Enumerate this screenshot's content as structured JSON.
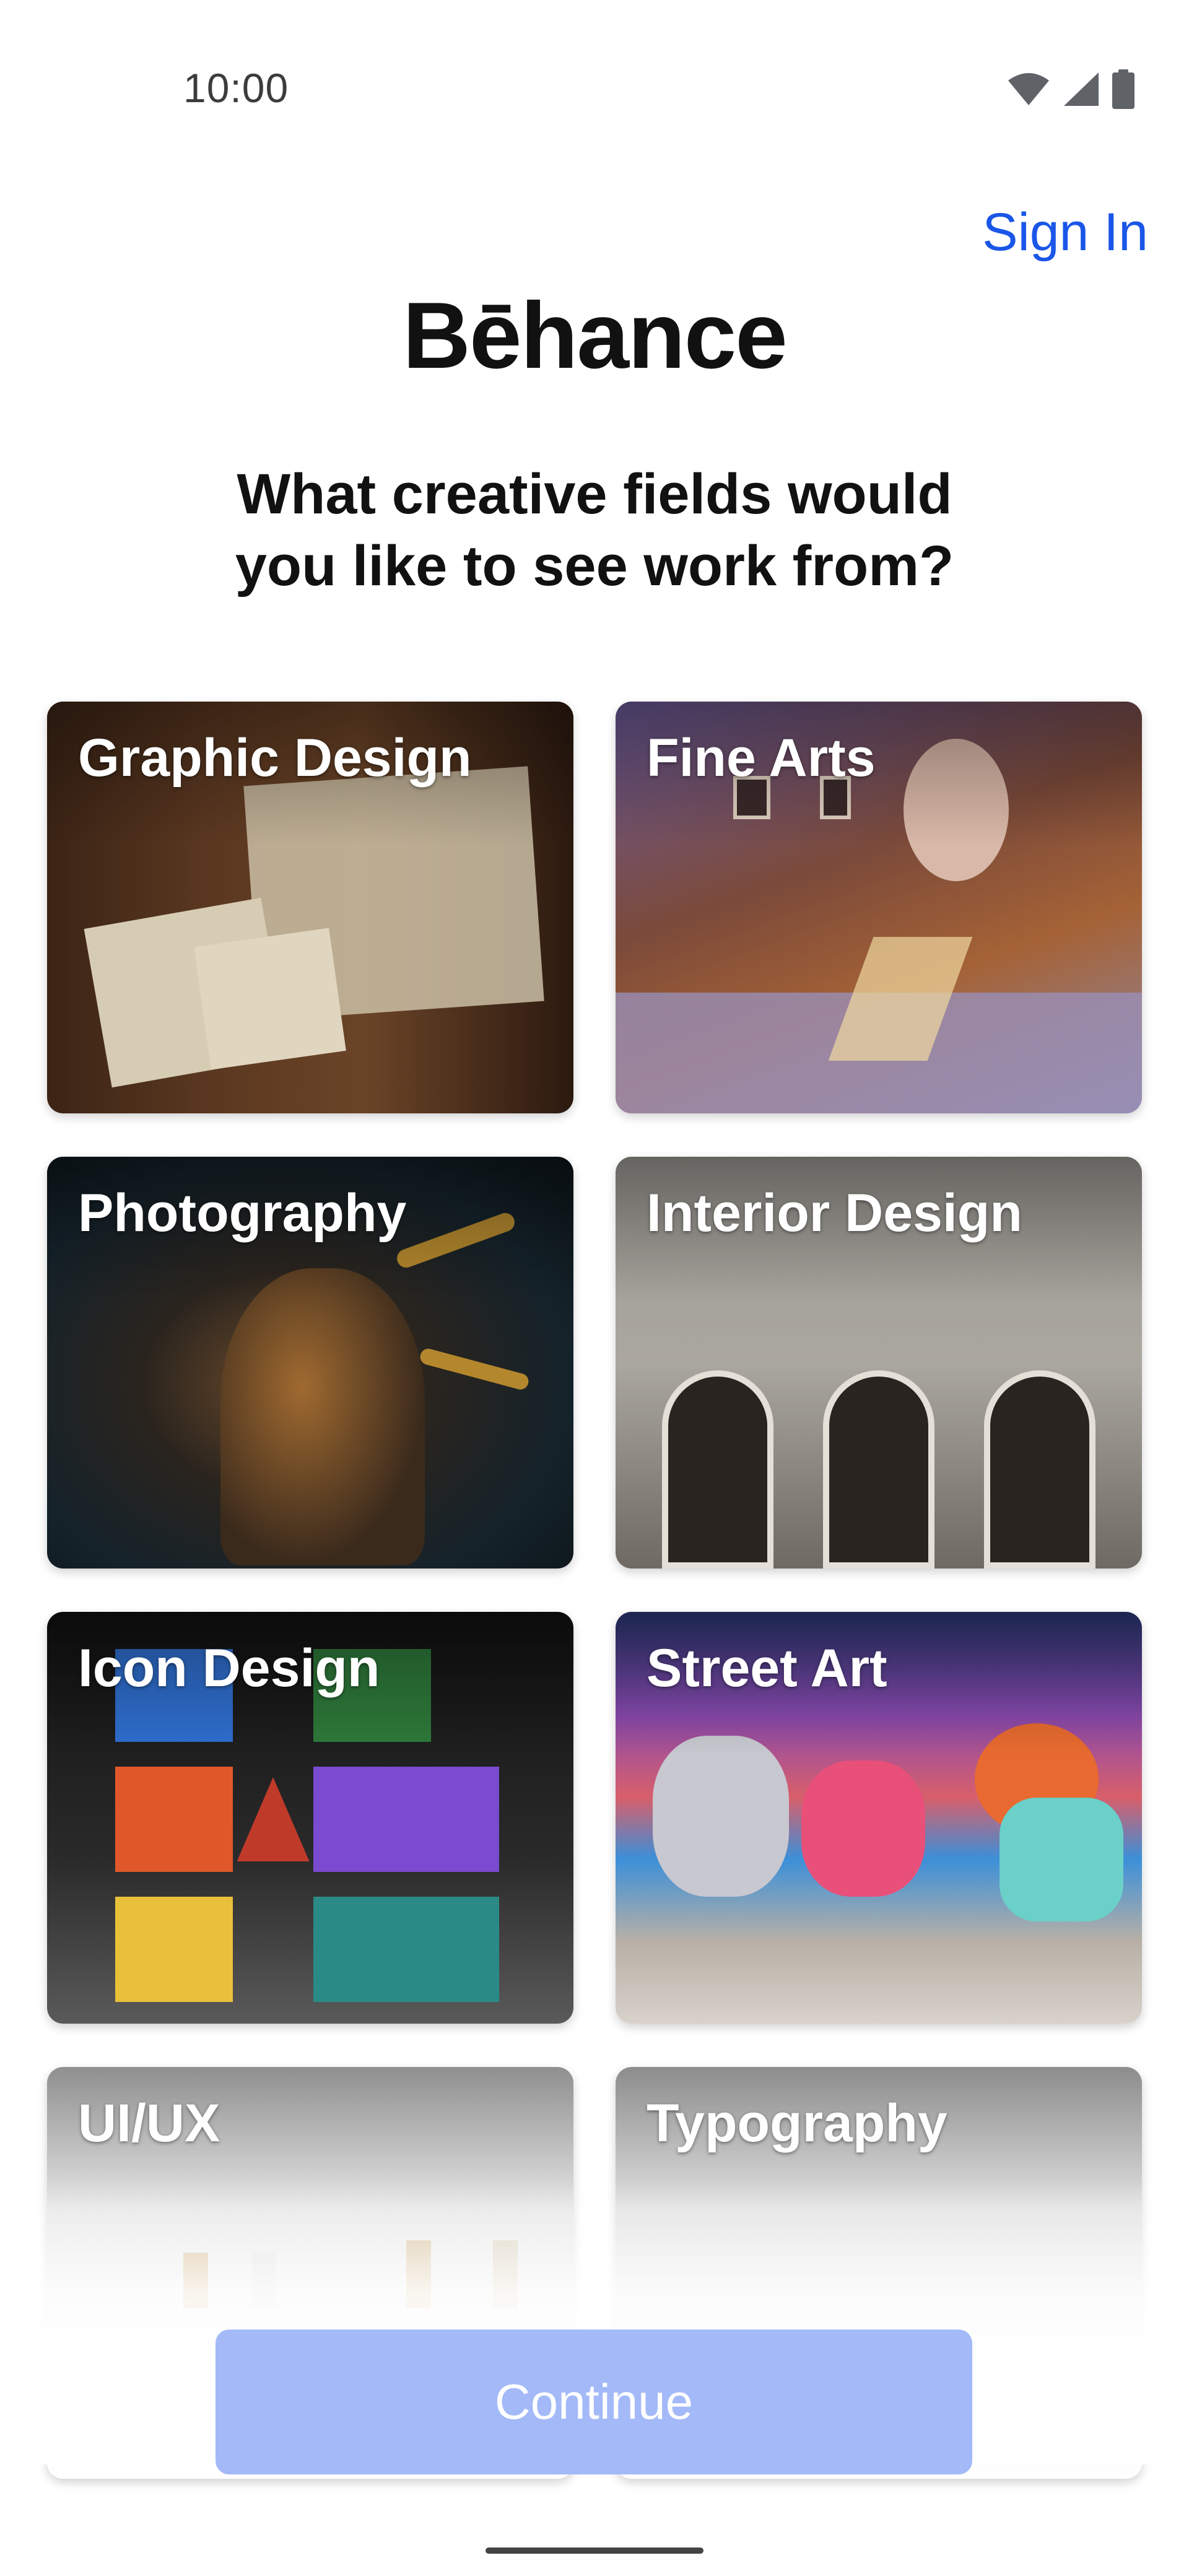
{
  "status_bar": {
    "time": "10:00",
    "icons": [
      "wifi-icon",
      "signal-icon",
      "battery-icon"
    ]
  },
  "header": {
    "sign_in_label": "Sign In",
    "logo_text": "Bēhance"
  },
  "question": {
    "line1": "What creative fields would",
    "line2": "you like to see work from?"
  },
  "fields": [
    {
      "label": "Graphic Design"
    },
    {
      "label": "Fine Arts"
    },
    {
      "label": "Photography"
    },
    {
      "label": "Interior Design"
    },
    {
      "label": "Icon Design"
    },
    {
      "label": "Street Art"
    },
    {
      "label": "UI/UX"
    },
    {
      "label": "Typography"
    }
  ],
  "footer": {
    "continue_label": "Continue"
  },
  "colors": {
    "accent": "#1a56e8",
    "continue_disabled": "#a3b9f8"
  }
}
